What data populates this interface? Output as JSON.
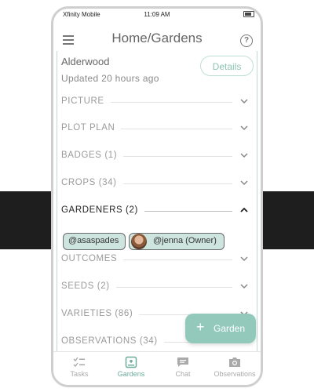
{
  "status_bar": {
    "carrier": "Xfinity Mobile",
    "time": "11:09 AM"
  },
  "header": {
    "title": "Home/Gardens"
  },
  "garden": {
    "name": "Alderwood",
    "updated": "Updated 20 hours ago",
    "details_label": "Details"
  },
  "sections": [
    {
      "label": "PICTURE"
    },
    {
      "label": "PLOT PLAN"
    },
    {
      "label": "BADGES  (1)"
    },
    {
      "label": "CROPS  (34)"
    },
    {
      "label": "GARDENERS  (2)"
    },
    {
      "label": "OUTCOMES"
    },
    {
      "label": "SEEDS  (2)"
    },
    {
      "label": "VARIETIES  (86)"
    },
    {
      "label": "OBSERVATIONS  (34)"
    }
  ],
  "gardeners": [
    {
      "handle": "@asaspades"
    },
    {
      "handle": "@jenna (Owner)"
    }
  ],
  "fab": {
    "label": "Garden"
  },
  "tabs": [
    {
      "label": "Tasks",
      "icon": "tasks-icon"
    },
    {
      "label": "Gardens",
      "icon": "gardens-icon"
    },
    {
      "label": "Chat",
      "icon": "chat-icon"
    },
    {
      "label": "Observations",
      "icon": "camera-icon"
    }
  ],
  "colors": {
    "accent": "#92c9ba",
    "chip_bg": "#cde5de",
    "active_tab": "#6dab9b"
  }
}
